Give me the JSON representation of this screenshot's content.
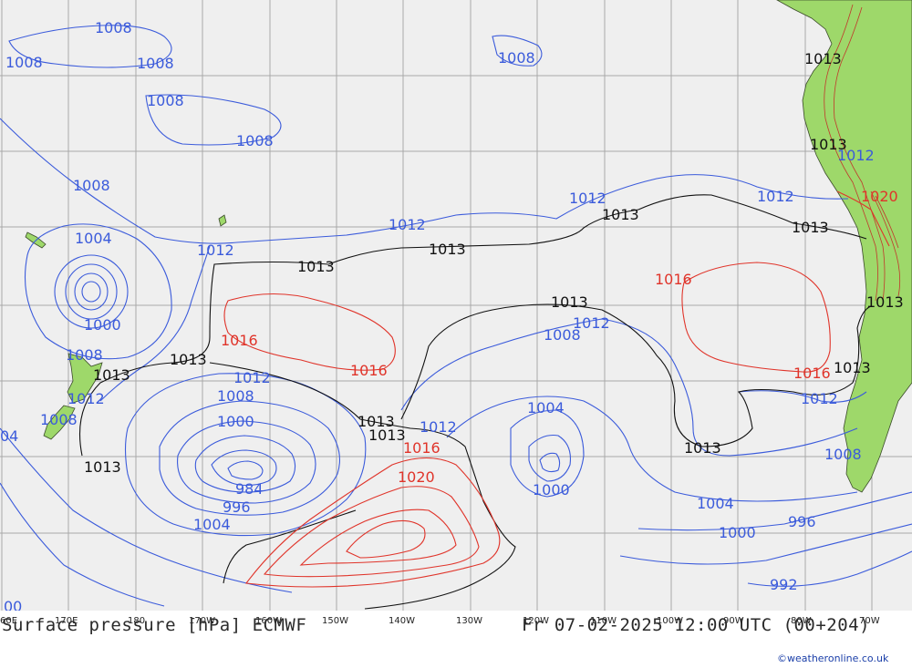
{
  "map": {
    "title": "Surface pressure [hPa] ECMWF",
    "valid_time": "Fr 07-02-2025 12:00 UTC (00+204)",
    "credit": "©weatheronline.co.uk",
    "longitude_ticks": [
      "60E",
      "170E",
      "180",
      "170W",
      "160W",
      "150W",
      "140W",
      "130W",
      "120W",
      "110W",
      "100W",
      "90W",
      "80W",
      "70W"
    ],
    "colors": {
      "ocean": "#efefef",
      "land": "#9ed86a",
      "grid": "#a9a9a9",
      "isobar_low": "#3b5bdb",
      "isobar_ref": "#111111",
      "isobar_high": "#e0342a",
      "footer_text": "#2a2a2a",
      "credit_text": "#1a3ea8"
    },
    "isobar_labels": [
      {
        "text": "1008",
        "group": "low"
      },
      {
        "text": "1008",
        "group": "low"
      },
      {
        "text": "1008",
        "group": "low"
      },
      {
        "text": "1008",
        "group": "low"
      },
      {
        "text": "1008",
        "group": "low"
      },
      {
        "text": "1008",
        "group": "low"
      },
      {
        "text": "1008",
        "group": "low"
      },
      {
        "text": "1004",
        "group": "low"
      },
      {
        "text": "1000",
        "group": "low"
      },
      {
        "text": "1008",
        "group": "low"
      },
      {
        "text": "1012",
        "group": "low"
      },
      {
        "text": "1008",
        "group": "low"
      },
      {
        "text": "1012",
        "group": "low"
      },
      {
        "text": "1012",
        "group": "low"
      },
      {
        "text": "1012",
        "group": "low"
      },
      {
        "text": "1012",
        "group": "low"
      },
      {
        "text": "1008",
        "group": "low"
      },
      {
        "text": "1000",
        "group": "low"
      },
      {
        "text": "984",
        "group": "low"
      },
      {
        "text": "996",
        "group": "low"
      },
      {
        "text": "1004",
        "group": "low"
      },
      {
        "text": "1012",
        "group": "low"
      },
      {
        "text": "1012",
        "group": "low"
      },
      {
        "text": "1008",
        "group": "low"
      },
      {
        "text": "1004",
        "group": "low"
      },
      {
        "text": "1000",
        "group": "low"
      },
      {
        "text": "1004",
        "group": "low"
      },
      {
        "text": "1000",
        "group": "low"
      },
      {
        "text": "996",
        "group": "low"
      },
      {
        "text": "992",
        "group": "low"
      },
      {
        "text": "1012",
        "group": "low"
      },
      {
        "text": "1008",
        "group": "low"
      },
      {
        "text": "1012",
        "group": "low"
      },
      {
        "text": "1012",
        "group": "low"
      },
      {
        "text": "04",
        "group": "low"
      },
      {
        "text": "00",
        "group": "low"
      },
      {
        "text": "1013",
        "group": "ref"
      },
      {
        "text": "1013",
        "group": "ref"
      },
      {
        "text": "1013",
        "group": "ref"
      },
      {
        "text": "1013",
        "group": "ref"
      },
      {
        "text": "1013",
        "group": "ref"
      },
      {
        "text": "1013",
        "group": "ref"
      },
      {
        "text": "1013",
        "group": "ref"
      },
      {
        "text": "1013",
        "group": "ref"
      },
      {
        "text": "1013",
        "group": "ref"
      },
      {
        "text": "1013",
        "group": "ref"
      },
      {
        "text": "1013",
        "group": "ref"
      },
      {
        "text": "1013",
        "group": "ref"
      },
      {
        "text": "1013",
        "group": "ref"
      },
      {
        "text": "1013",
        "group": "ref"
      },
      {
        "text": "1016",
        "group": "high"
      },
      {
        "text": "1016",
        "group": "high"
      },
      {
        "text": "1016",
        "group": "high"
      },
      {
        "text": "1016",
        "group": "high"
      },
      {
        "text": "1016",
        "group": "high"
      },
      {
        "text": "1020",
        "group": "high"
      },
      {
        "text": "1020",
        "group": "high"
      }
    ]
  }
}
